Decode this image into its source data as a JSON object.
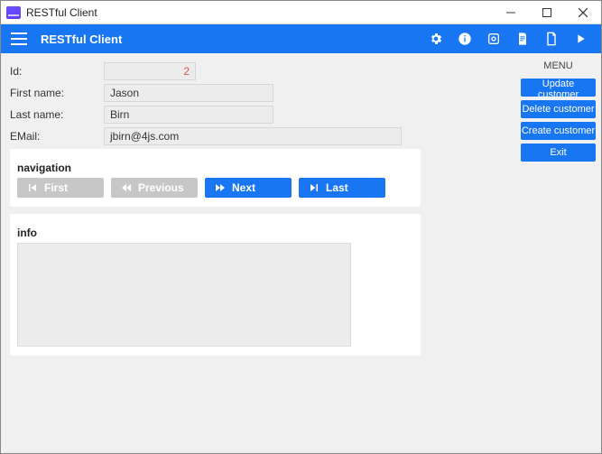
{
  "window": {
    "title": "RESTful Client"
  },
  "appbar": {
    "title": "RESTful Client"
  },
  "form": {
    "id_label": "Id:",
    "id_value": "2",
    "first_name_label": "First name:",
    "first_name_value": "Jason",
    "last_name_label": "Last name:",
    "last_name_value": "Birn",
    "email_label": "EMail:",
    "email_value": "jbirn@4js.com"
  },
  "sections": {
    "navigation_title": "navigation",
    "info_title": "info"
  },
  "nav": {
    "first": "First",
    "previous": "Previous",
    "next": "Next",
    "last": "Last"
  },
  "info": {
    "text": ""
  },
  "menu": {
    "title": "MENU",
    "update": "Update customer",
    "delete": "Delete customer",
    "create": "Create customer",
    "exit": "Exit"
  }
}
